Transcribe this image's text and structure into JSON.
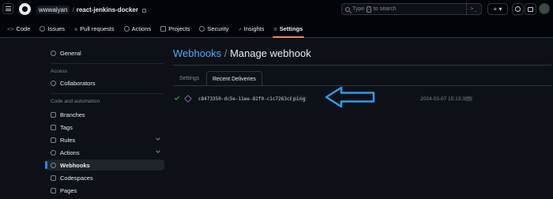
{
  "header": {
    "owner": "wwwaiyan",
    "separator": "/",
    "repo": "react-jenkins-docker",
    "search_placeholder": "Type / to search",
    "search_prefix": "Type",
    "search_key": "/",
    "search_suffix": "to search",
    "cmd_label": ">_",
    "plus_label": "+ ▾"
  },
  "repo_tabs": [
    {
      "label": "Code",
      "icon": "code-icon"
    },
    {
      "label": "Issues",
      "icon": "issue-icon"
    },
    {
      "label": "Pull requests",
      "icon": "pull-request-icon"
    },
    {
      "label": "Actions",
      "icon": "play-icon"
    },
    {
      "label": "Projects",
      "icon": "table-icon"
    },
    {
      "label": "Security",
      "icon": "shield-icon"
    },
    {
      "label": "Insights",
      "icon": "graph-icon"
    },
    {
      "label": "Settings",
      "icon": "gear-icon",
      "active": true
    }
  ],
  "sidebar": {
    "general": "General",
    "access_heading": "Access",
    "collaborators": "Collaborators",
    "code_heading": "Code and automation",
    "branches": "Branches",
    "tags": "Tags",
    "rules": "Rules",
    "actions": "Actions",
    "webhooks": "Webhooks",
    "codespaces": "Codespaces",
    "pages": "Pages"
  },
  "main": {
    "title_link": "Webhooks",
    "title_sep": "/",
    "title_rest": "Manage webhook",
    "tabs": {
      "settings": "Settings",
      "recent": "Recent Deliveries"
    },
    "delivery": {
      "guid": "c8473350-dc5e-11ee-82f0-c1c7263c8f2f",
      "event": "ping",
      "timestamp": "2024-03-07 15:13:34",
      "more": "···",
      "status": "success"
    }
  },
  "colors": {
    "accent": "#2f81f7",
    "active_tab_underline": "#f78166",
    "annotation_arrow": "#2f9be8",
    "success": "#3fb950"
  }
}
